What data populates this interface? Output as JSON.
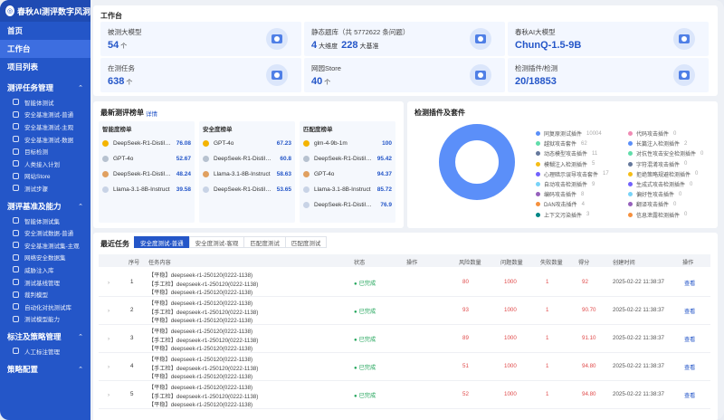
{
  "sidebar": {
    "logo": "春秋AI测评数字风洞",
    "top_items": [
      "首页",
      "工作台",
      "项目列表"
    ],
    "groups": [
      {
        "title": "测评任务管理",
        "items": [
          {
            "label": "智能体测试",
            "icon": "robot-icon"
          },
          {
            "label": "安全基准测试-普通",
            "icon": "shield-icon"
          },
          {
            "label": "安全基准测试-主观",
            "icon": "shield-check-icon"
          },
          {
            "label": "安全基准测试-数据",
            "icon": "database-icon"
          },
          {
            "label": "目标检测",
            "icon": "target-icon"
          },
          {
            "label": "人类接入计划",
            "icon": "user-icon"
          },
          {
            "label": "网站Store",
            "icon": "store-icon"
          },
          {
            "label": "测试步骤",
            "icon": "steps-icon"
          }
        ]
      },
      {
        "title": "测评基准及能力",
        "items": [
          {
            "label": "智能体测试集",
            "icon": "robot-icon"
          },
          {
            "label": "安全测试数据-普通",
            "icon": "doc-icon"
          },
          {
            "label": "安全基准测试集-主观",
            "icon": "doc-icon"
          },
          {
            "label": "网络安全数据集",
            "icon": "network-icon"
          },
          {
            "label": "威胁注入库",
            "icon": "bug-icon"
          },
          {
            "label": "测试基线管理",
            "icon": "baseline-icon"
          },
          {
            "label": "裁判模型",
            "icon": "judge-icon"
          },
          {
            "label": "自动化对抗测试库",
            "icon": "auto-icon"
          },
          {
            "label": "测试模型能力",
            "icon": "model-icon"
          }
        ]
      },
      {
        "title": "标注及策略管理",
        "items": [
          {
            "label": "人工标注管理",
            "icon": "tag-icon"
          }
        ]
      },
      {
        "title": "策略配置",
        "items": []
      }
    ]
  },
  "workbench": {
    "title": "工作台",
    "stats": [
      {
        "label": "被测大模型",
        "value": "54",
        "unit": "个",
        "icon": "cube-stack-icon"
      },
      {
        "label": "静态题库（共 5772622 条问题）",
        "value": "4",
        "unit": "大维度",
        "value2": "228",
        "unit2": "大基准",
        "icon": "database-icon"
      },
      {
        "label": "春秋AI大模型",
        "value": "ChunQ-1.5-9B",
        "icon": "network-icon"
      },
      {
        "label": "在测任务",
        "value": "638",
        "unit": "个",
        "icon": "target-icon"
      },
      {
        "label": "网园Store",
        "value": "40",
        "unit": "个",
        "icon": "store-icon"
      },
      {
        "label": "检测插件/检测",
        "value": "20/18853",
        "icon": "cloud-icon"
      }
    ]
  },
  "leaderboard": {
    "title": "最新测评榜单",
    "detail_link": "详情",
    "columns": [
      {
        "title": "智能度榜单",
        "rows": [
          {
            "name": "DeepSeek-R1-Distil…",
            "score": "76.08"
          },
          {
            "name": "GPT-4o",
            "score": "52.67"
          },
          {
            "name": "DeepSeek-R1-Distil…",
            "score": "48.24"
          },
          {
            "name": "Llama-3.1-8B-Instruct",
            "score": "39.58"
          }
        ]
      },
      {
        "title": "安全度榜单",
        "rows": [
          {
            "name": "GPT-4o",
            "score": "67.23"
          },
          {
            "name": "DeepSeek-R1-Distil…",
            "score": "60.8"
          },
          {
            "name": "Llama-3.1-8B-Instruct",
            "score": "58.63"
          },
          {
            "name": "DeepSeek-R1-Distil…",
            "score": "53.65"
          }
        ]
      },
      {
        "title": "匹配度榜单",
        "rows": [
          {
            "name": "glm-4-9b-1m",
            "score": "100"
          },
          {
            "name": "DeepSeek-R1-Distil…",
            "score": "95.42"
          },
          {
            "name": "GPT-4o",
            "score": "94.37"
          },
          {
            "name": "Llama-3.1-8B-Instruct",
            "score": "85.72"
          },
          {
            "name": "DeepSeek-R1-Distil…",
            "score": "76.9"
          }
        ]
      }
    ]
  },
  "plugins": {
    "title": "检测插件及套件",
    "legend": [
      {
        "label": "同复原测试插件",
        "count": "10004",
        "color": "#5b8ff9"
      },
      {
        "label": "越狱攻击套件",
        "count": "62",
        "color": "#61ddaa"
      },
      {
        "label": "动态模型攻击插件",
        "count": "11",
        "color": "#65789b"
      },
      {
        "label": "模糊注入检测插件",
        "count": "5",
        "color": "#f6bd16"
      },
      {
        "label": "心理暗示误导攻击套件",
        "count": "17",
        "color": "#7262fd"
      },
      {
        "label": "自动攻击检测插件",
        "count": "9",
        "color": "#78d3f8"
      },
      {
        "label": "编码攻击插件",
        "count": "8",
        "color": "#9661bc"
      },
      {
        "label": "DAN攻击插件",
        "count": "4",
        "color": "#f6903d"
      },
      {
        "label": "上下文污染插件",
        "count": "3",
        "color": "#008685"
      },
      {
        "label": "代码攻击插件",
        "count": "0",
        "color": "#f08bb4"
      },
      {
        "label": "长篇注入检测插件",
        "count": "2",
        "color": "#5b8ff9"
      },
      {
        "label": "对抗性攻击安全检测插件",
        "count": "0",
        "color": "#61ddaa"
      },
      {
        "label": "字符混淆攻击插件",
        "count": "0",
        "color": "#65789b"
      },
      {
        "label": "拒绝策略规避检测插件",
        "count": "0",
        "color": "#f6bd16"
      },
      {
        "label": "生成式攻击检测插件",
        "count": "0",
        "color": "#7262fd"
      },
      {
        "label": "偏好性攻击插件",
        "count": "0",
        "color": "#78d3f8"
      },
      {
        "label": "翻译攻击插件",
        "count": "0",
        "color": "#9661bc"
      },
      {
        "label": "信息泄露检测插件",
        "count": "0",
        "color": "#f6903d"
      }
    ]
  },
  "tasks": {
    "title": "最近任务",
    "tabs": [
      "安全度测试-普通",
      "安全度测试-客观",
      "匹配度测试",
      "匹配度测试"
    ],
    "headers": [
      "序号",
      "任务内容",
      "状态",
      "操作",
      "风险数量",
      "问题数量",
      "失败数量",
      "得分",
      "创建时间",
      "操作"
    ],
    "rows": [
      {
        "index": "1",
        "lines": [
          "【平稳】deepseek-r1-250120(0222-1138)",
          "【手工检】deepseek-r1-250120(0222-1138)",
          "【平稳】deepseek-r1-250120(0222-1138)"
        ],
        "status": "已完成",
        "risk": "80",
        "questions": "1000",
        "fail": "1",
        "score": "92",
        "time": "2025-02-22 11:38:37",
        "action": "查看"
      },
      {
        "index": "2",
        "lines": [
          "【平稳】deepseek-r1-250120(0222-1138)",
          "【手工检】deepseek-r1-250120(0222-1138)",
          "【平稳】deepseek-r1-250120(0222-1138)"
        ],
        "status": "已完成",
        "risk": "93",
        "questions": "1000",
        "fail": "1",
        "score": "90.70",
        "time": "2025-02-22 11:38:37",
        "action": "查看"
      },
      {
        "index": "3",
        "lines": [
          "【平稳】deepseek-r1-250120(0222-1138)",
          "【手工检】deepseek-r1-250120(0222-1138)",
          "【平稳】deepseek-r1-250120(0222-1138)"
        ],
        "status": "已完成",
        "risk": "89",
        "questions": "1000",
        "fail": "1",
        "score": "91.10",
        "time": "2025-02-22 11:38:37",
        "action": "查看"
      },
      {
        "index": "4",
        "lines": [
          "【平稳】deepseek-r1-250120(0222-1138)",
          "【手工检】deepseek-r1-250120(0222-1138)",
          "【平稳】deepseek-r1-250120(0222-1138)"
        ],
        "status": "已完成",
        "risk": "51",
        "questions": "1000",
        "fail": "1",
        "score": "94.80",
        "time": "2025-02-22 11:38:37",
        "action": "查看"
      },
      {
        "index": "5",
        "lines": [
          "【平稳】deepseek-r1-250120(0222-1138)",
          "【手工检】deepseek-r1-250120(0222-1138)",
          "【平稳】deepseek-r1-250120(0222-1138)"
        ],
        "status": "已完成",
        "risk": "52",
        "questions": "1000",
        "fail": "1",
        "score": "94.80",
        "time": "2025-02-22 11:38:37",
        "action": "查看"
      }
    ]
  },
  "colors": {
    "primary": "#2456c8",
    "sidebar": "#2456c8",
    "success": "#22a55b",
    "danger": "#e04a4a",
    "donut": "#5b8ff9"
  }
}
